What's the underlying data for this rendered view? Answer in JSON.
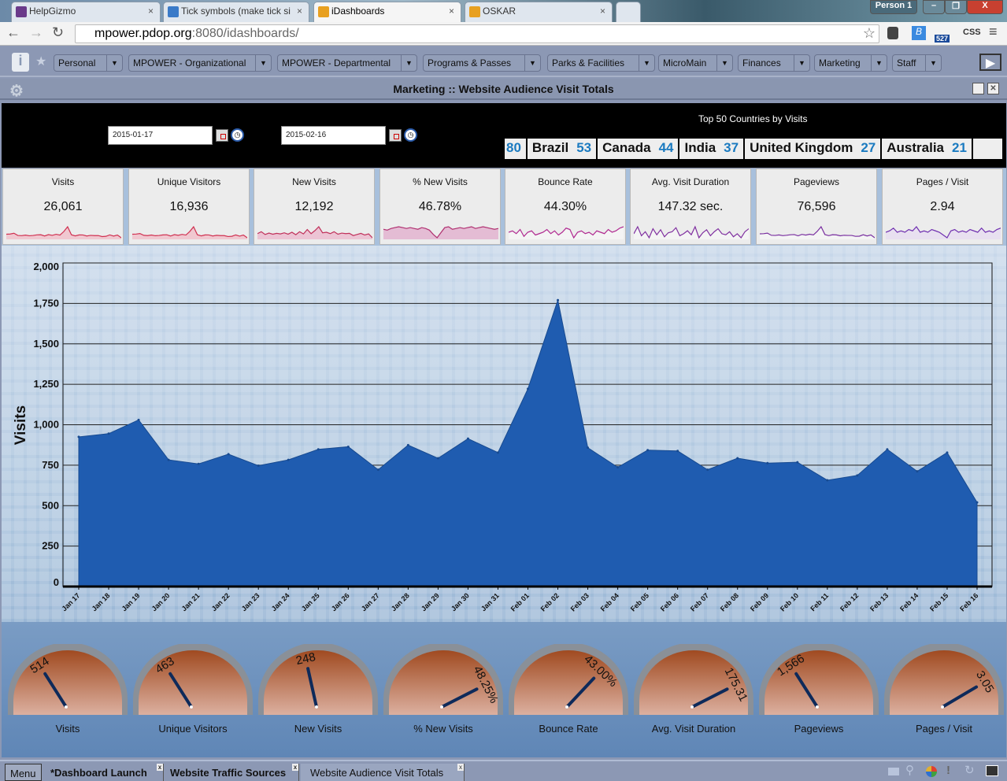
{
  "browser": {
    "tabs": [
      {
        "label": "HelpGizmo",
        "favicon": "hg",
        "color": "#6a3a8a"
      },
      {
        "label": "Tick symbols (make tick si",
        "favicon": "heart-icon",
        "color": "#3a7ac8"
      },
      {
        "label": "iDashboards",
        "favicon": "idashboards-icon",
        "color": "#e8a020"
      },
      {
        "label": "OSKAR",
        "favicon": "idashboards-icon",
        "color": "#e8a020"
      }
    ],
    "close_glyph": "×",
    "profile": "Person 1",
    "url_host": "mpower.pdop.org",
    "url_rest": ":8080/idashboards/",
    "extension_badge": "527",
    "css_ext": "CSS"
  },
  "menu": {
    "items": [
      "Personal",
      "MPOWER - Organizational",
      "MPOWER - Departmental",
      "Programs & Passes",
      "Parks & Facilities",
      "MicroMain",
      "Finances",
      "Marketing",
      "Staff"
    ]
  },
  "dashboard": {
    "title": "Marketing :: Website Audience Visit Totals"
  },
  "filters": {
    "start_date": "2015-01-17",
    "end_date": "2015-02-16"
  },
  "countries": {
    "title": "Top 50 Countries by Visits",
    "items": [
      {
        "name": "",
        "value": "80"
      },
      {
        "name": "Brazil",
        "value": "53"
      },
      {
        "name": "Canada",
        "value": "44"
      },
      {
        "name": "India",
        "value": "37"
      },
      {
        "name": "United Kingdom",
        "value": "27"
      },
      {
        "name": "Australia",
        "value": "21"
      }
    ]
  },
  "kpis": [
    {
      "label": "Visits",
      "value": "26,061",
      "color": "#d03050",
      "fill": "#f0c8d0",
      "spark": [
        925,
        945,
        1030,
        783,
        758,
        818,
        747,
        783,
        848,
        864,
        722,
        874,
        793,
        914,
        828,
        1222,
        1770,
        858,
        737,
        843,
        838,
        722,
        793,
        763,
        768,
        657,
        687,
        848,
        712,
        828,
        520
      ]
    },
    {
      "label": "Unique Visitors",
      "value": "16,936",
      "color": "#d03050",
      "fill": "#f0c8d0",
      "spark": [
        600,
        610,
        650,
        520,
        500,
        540,
        490,
        510,
        550,
        560,
        470,
        570,
        520,
        590,
        540,
        800,
        1150,
        560,
        480,
        550,
        545,
        470,
        520,
        500,
        500,
        430,
        450,
        550,
        460,
        540,
        340
      ]
    },
    {
      "label": "New Visits",
      "value": "12,192",
      "color": "#c0305a",
      "fill": "#ecc4d4",
      "spark": [
        450,
        520,
        420,
        470,
        430,
        460,
        440,
        480,
        430,
        500,
        410,
        520,
        440,
        600,
        450,
        560,
        700,
        480,
        500,
        450,
        520,
        430,
        470,
        450,
        460,
        380,
        420,
        460,
        400,
        440,
        300
      ]
    },
    {
      "label": "% New Visits",
      "value": "46.78%",
      "color": "#b03070",
      "fill": "#e4bcd4",
      "spark": [
        46,
        45,
        47,
        48,
        49,
        48,
        47,
        48,
        47,
        46,
        48,
        47,
        45,
        40,
        36,
        42,
        48,
        49,
        46,
        47,
        48,
        47,
        48,
        49,
        47,
        48,
        49,
        48,
        47,
        46,
        47
      ]
    },
    {
      "label": "Bounce Rate",
      "value": "44.30%",
      "color": "#b02890",
      "fill": "#f4f4f4",
      "spark": [
        44,
        45,
        43,
        46,
        41,
        44,
        45,
        42,
        43,
        44,
        46,
        43,
        45,
        42,
        44,
        47,
        46,
        40,
        44,
        45,
        43,
        44,
        42,
        45,
        44,
        43,
        46,
        44,
        45,
        47,
        48
      ]
    },
    {
      "label": "Avg. Visit Duration",
      "value": "147.32 sec.",
      "color": "#8030a0",
      "fill": "#f4f4f4",
      "spark": [
        140,
        175,
        130,
        150,
        120,
        165,
        135,
        160,
        125,
        145,
        150,
        170,
        130,
        140,
        155,
        135,
        175,
        120,
        145,
        160,
        130,
        150,
        165,
        140,
        135,
        150,
        125,
        140,
        120,
        150,
        165
      ]
    },
    {
      "label": "Pageviews",
      "value": "76,596",
      "color": "#7a30a0",
      "fill": "#f4f4f4",
      "spark": [
        2700,
        2750,
        2900,
        2300,
        2250,
        2400,
        2200,
        2300,
        2450,
        2500,
        2150,
        2550,
        2350,
        2600,
        2400,
        3400,
        4700,
        2500,
        2200,
        2450,
        2400,
        2150,
        2300,
        2250,
        2250,
        2000,
        2050,
        2450,
        2100,
        2400,
        1600
      ]
    },
    {
      "label": "Pages / Visit",
      "value": "2.94",
      "color": "#7030b0",
      "fill": "#e8e0f0",
      "spark": [
        2.9,
        2.95,
        3.05,
        2.9,
        2.95,
        2.9,
        3.0,
        2.95,
        3.1,
        2.9,
        2.95,
        2.9,
        3.0,
        2.95,
        2.9,
        2.8,
        2.7,
        2.95,
        3.0,
        2.9,
        2.95,
        2.9,
        3.0,
        2.95,
        2.9,
        3.05,
        2.9,
        2.95,
        2.9,
        3.0,
        3.05
      ]
    }
  ],
  "chart_data": {
    "type": "area",
    "title": "",
    "xlabel": "",
    "ylabel": "Visits",
    "ylim": [
      0,
      2000
    ],
    "grid": true,
    "yticks": [
      "0",
      "250",
      "500",
      "750",
      "1,000",
      "1,250",
      "1,500",
      "1,750",
      "2,000"
    ],
    "categories": [
      "Jan 17",
      "Jan 18",
      "Jan 19",
      "Jan 20",
      "Jan 21",
      "Jan 22",
      "Jan 23",
      "Jan 24",
      "Jan 25",
      "Jan 26",
      "Jan 27",
      "Jan 28",
      "Jan 29",
      "Jan 30",
      "Jan 31",
      "Feb 01",
      "Feb 02",
      "Feb 03",
      "Feb 04",
      "Feb 05",
      "Feb 06",
      "Feb 07",
      "Feb 08",
      "Feb 09",
      "Feb 10",
      "Feb 11",
      "Feb 12",
      "Feb 13",
      "Feb 14",
      "Feb 15",
      "Feb 16"
    ],
    "series": [
      {
        "name": "Visits",
        "color": "#1f5cb0",
        "values": [
          925,
          945,
          1030,
          783,
          758,
          818,
          747,
          783,
          848,
          864,
          722,
          874,
          793,
          914,
          828,
          1222,
          1770,
          858,
          737,
          843,
          838,
          722,
          793,
          763,
          768,
          657,
          687,
          848,
          712,
          828,
          520
        ]
      }
    ]
  },
  "gauges": [
    {
      "label": "Visits",
      "value": "514",
      "level": 0.32
    },
    {
      "label": "Unique Visitors",
      "value": "463",
      "level": 0.32
    },
    {
      "label": "New Visits",
      "value": "248",
      "level": 0.43
    },
    {
      "label": "% New Visits",
      "value": "48.25%",
      "level": 0.85
    },
    {
      "label": "Bounce Rate",
      "value": "43.00%",
      "level": 0.74
    },
    {
      "label": "Avg. Visit Duration",
      "value": "175.31",
      "level": 0.85
    },
    {
      "label": "Pageviews",
      "value": "1,566",
      "level": 0.32
    },
    {
      "label": "Pages / Visit",
      "value": "3.05",
      "level": 0.83
    }
  ],
  "taskbar": {
    "menu": "Menu",
    "tabs": [
      "*Dashboard Launch",
      "Website Traffic Sources",
      "Website Audience Visit Totals"
    ],
    "close": "x"
  }
}
